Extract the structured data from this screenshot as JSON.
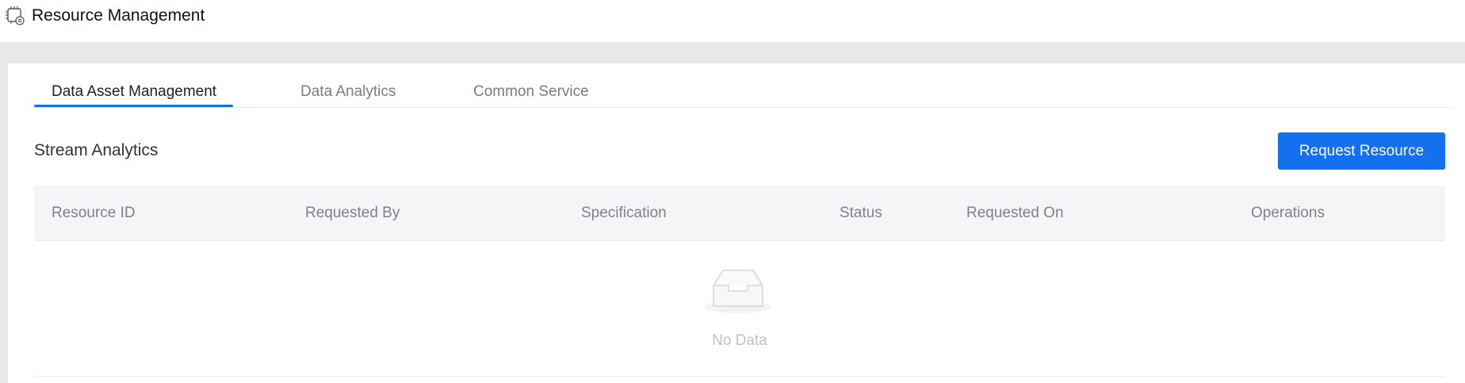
{
  "header": {
    "app_icon": "resource-chip-icon",
    "title": "Resource Management"
  },
  "tabs": [
    {
      "label": "Data Asset Management",
      "active": true
    },
    {
      "label": "Data Analytics",
      "active": false
    },
    {
      "label": "Common Service",
      "active": false
    }
  ],
  "section": {
    "title": "Stream Analytics",
    "action_label": "Request Resource"
  },
  "table": {
    "columns": [
      "Resource ID",
      "Requested By",
      "Specification",
      "Status",
      "Requested On",
      "Operations"
    ],
    "rows": [],
    "empty_icon": "empty-inbox-icon",
    "empty_text": "No Data"
  },
  "colors": {
    "accent": "#1570ef",
    "header_bg": "#f5f5f8",
    "page_bg": "#e8e8e8"
  }
}
